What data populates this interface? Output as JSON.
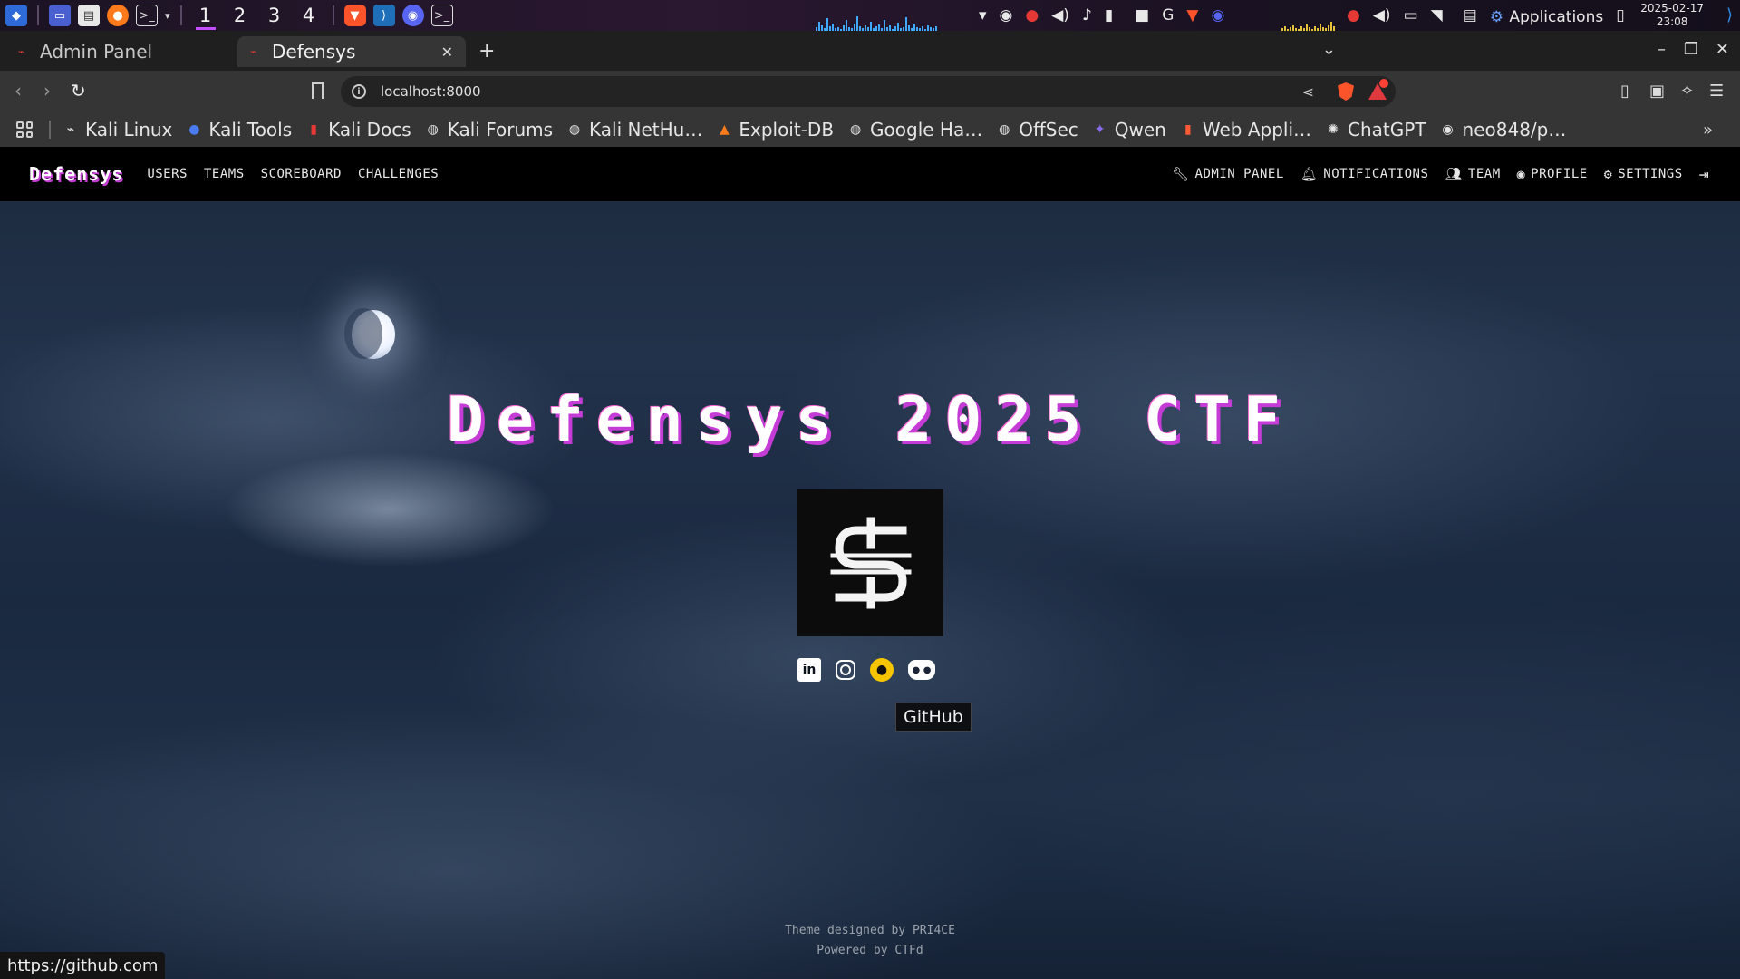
{
  "os": {
    "workspaces": [
      "1",
      "2",
      "3",
      "4"
    ],
    "applications_label": "Applications",
    "date": "2025-02-17",
    "time": "23:08"
  },
  "browser": {
    "tabs": [
      {
        "label": "Admin Panel",
        "active": false
      },
      {
        "label": "Defensys",
        "active": true
      }
    ],
    "url": "localhost:8000",
    "bookmarks": [
      {
        "label": "Kali Linux",
        "icon": "kali-dragon-icon"
      },
      {
        "label": "Kali Tools",
        "icon": "kali-tools-icon"
      },
      {
        "label": "Kali Docs",
        "icon": "kali-docs-icon"
      },
      {
        "label": "Kali Forums",
        "icon": "globe-icon"
      },
      {
        "label": "Kali NetHu…",
        "icon": "globe-icon"
      },
      {
        "label": "Exploit-DB",
        "icon": "exploitdb-icon"
      },
      {
        "label": "Google Ha…",
        "icon": "globe-icon"
      },
      {
        "label": "OffSec",
        "icon": "globe-icon"
      },
      {
        "label": "Qwen",
        "icon": "qwen-icon"
      },
      {
        "label": "Web Appli…",
        "icon": "web-app-icon"
      },
      {
        "label": "ChatGPT",
        "icon": "chatgpt-icon"
      },
      {
        "label": "neo848/p…",
        "icon": "github-icon"
      }
    ],
    "status_url": "https://github.com"
  },
  "ctf": {
    "brand": "Defensys",
    "nav_left": [
      "USERS",
      "TEAMS",
      "SCOREBOARD",
      "CHALLENGES"
    ],
    "nav_right": [
      {
        "label": "ADMIN PANEL",
        "icon": "wrench-icon"
      },
      {
        "label": "NOTIFICATIONS",
        "icon": "bell-icon"
      },
      {
        "label": "TEAM",
        "icon": "users-icon"
      },
      {
        "label": "PROFILE",
        "icon": "user-circle-icon"
      },
      {
        "label": "SETTINGS",
        "icon": "gears-icon"
      }
    ],
    "hero_title": "Defensys 2025 CTF",
    "tooltip": "GitHub",
    "footer_line1": "Theme designed by PRI4CE",
    "footer_line2": "Powered by CTFd"
  },
  "colors": {
    "accent": "#c53bd6",
    "github_icon": "#f7c500",
    "nav_bg": "#000000"
  }
}
